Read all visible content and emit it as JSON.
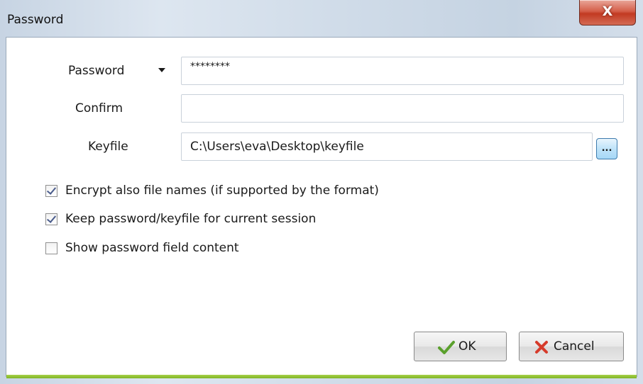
{
  "window": {
    "title": "Password",
    "close_glyph": "X"
  },
  "form": {
    "password": {
      "label": "Password",
      "value": "********"
    },
    "confirm": {
      "label": "Confirm",
      "value": ""
    },
    "keyfile": {
      "label": "Keyfile",
      "value": "C:\\Users\\eva\\Desktop\\keyfile",
      "browse_label": "..."
    }
  },
  "options": [
    {
      "label": "Encrypt also file names (if supported by the format)",
      "checked": true
    },
    {
      "label": "Keep password/keyfile for current session",
      "checked": true
    },
    {
      "label": "Show password field content",
      "checked": false
    }
  ],
  "buttons": {
    "ok_label": "OK",
    "cancel_label": "Cancel"
  },
  "colors": {
    "accent_bar": "#8bbd2c",
    "ok_check": "#5aa02c",
    "cancel_x": "#d63b2b",
    "close_button": "#c9442c"
  },
  "icons": {
    "ok": "checkmark-icon",
    "cancel": "x-icon",
    "password_menu": "dropdown-arrow-icon"
  }
}
